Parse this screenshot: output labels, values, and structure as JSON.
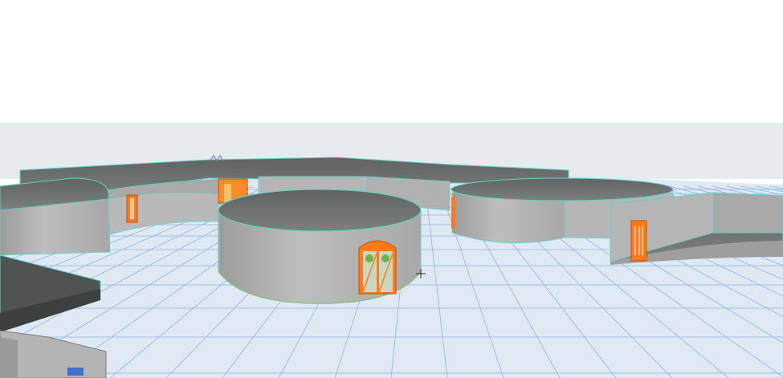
{
  "viewport": {
    "kind": "3d-model-view",
    "background_top": "#ffffff",
    "background_horizon": "#e6ebed",
    "floor_color": "#dfe9f3",
    "grid_color": "#8fb4e3",
    "wall_color": "#b3b3b3",
    "roof_color": "#6d716f",
    "outline_color": "#5fd3c8",
    "selection_color": "#ff7a1a",
    "cursor": "crosshair-cursor-icon"
  }
}
